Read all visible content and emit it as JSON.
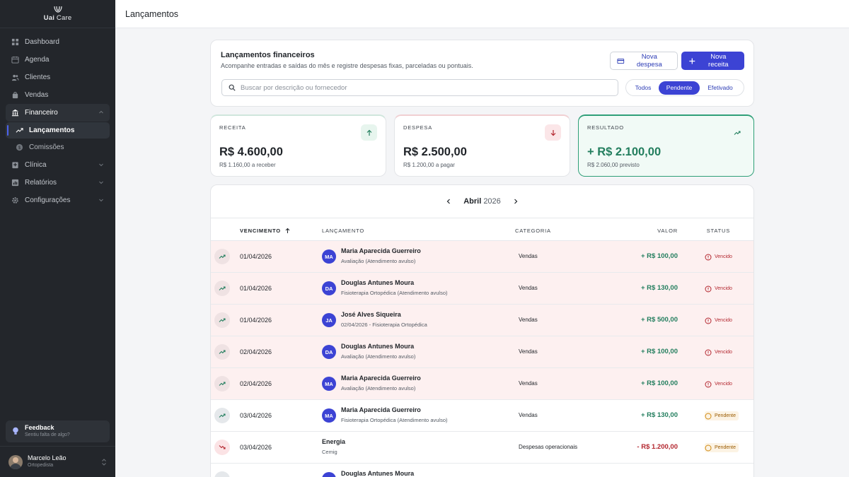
{
  "app": {
    "brand_bold": "Uai",
    "brand_light": "Care",
    "page_title": "Lançamentos"
  },
  "sidebar": {
    "items": [
      {
        "label": "Dashboard",
        "icon": "grid-icon"
      },
      {
        "label": "Agenda",
        "icon": "calendar-icon"
      },
      {
        "label": "Clientes",
        "icon": "users-icon"
      },
      {
        "label": "Vendas",
        "icon": "bag-icon"
      },
      {
        "label": "Financeiro",
        "icon": "bank-icon"
      },
      {
        "label": "Lançamentos",
        "icon": "trend-icon"
      },
      {
        "label": "Comissões",
        "icon": "coin-icon"
      },
      {
        "label": "Clínica",
        "icon": "clinic-icon"
      },
      {
        "label": "Relatórios",
        "icon": "chart-icon"
      },
      {
        "label": "Configurações",
        "icon": "gear-icon"
      }
    ],
    "feedback_title": "Feedback",
    "feedback_sub": "Sentiu falta de algo?",
    "user_name": "Marcelo Leão",
    "user_role": "Ortopedista"
  },
  "header": {
    "title": "Lançamentos financeiros",
    "subtitle": "Acompanhe entradas e saídas do mês e registre despesas fixas, parceladas ou pontuais.",
    "btn_despesa": "Nova despesa",
    "btn_receita": "Nova receita",
    "search_placeholder": "Buscar por descrição ou fornecedor",
    "filters": [
      "Todos",
      "Pendente",
      "Efetivado"
    ]
  },
  "summary": {
    "receita": {
      "label": "RECEITA",
      "value": "R$ 4.600,00",
      "note": "R$ 1.160,00 a receber"
    },
    "despesa": {
      "label": "DESPESA",
      "value": "R$ 2.500,00",
      "note": "R$ 1.200,00 a pagar"
    },
    "resultado": {
      "label": "RESULTADO",
      "value": "+ R$ 2.100,00",
      "note": "R$ 2.060,00 previsto"
    }
  },
  "month": {
    "name": "Abril",
    "year": "2026"
  },
  "table": {
    "headers": {
      "vencimento": "VENCIMENTO",
      "lancamento": "LANÇAMENTO",
      "categoria": "CATEGORIA",
      "valor": "VALOR",
      "status": "STATUS"
    },
    "rows": [
      {
        "date": "01/04/2026",
        "initials": "MA",
        "name": "Maria Aparecida Guerreiro",
        "desc": "Avaliação (Atendimento avulso)",
        "category": "Vendas",
        "value": "+ R$ 100,00",
        "status": "Vencido"
      },
      {
        "date": "01/04/2026",
        "initials": "DA",
        "name": "Douglas Antunes Moura",
        "desc": "Fisioterapia Ortopédica (Atendimento avulso)",
        "category": "Vendas",
        "value": "+ R$ 130,00",
        "status": "Vencido"
      },
      {
        "date": "01/04/2026",
        "initials": "JA",
        "name": "José Alves Siqueira",
        "desc": "02/04/2026 - Fisioterapia Ortopédica",
        "category": "Vendas",
        "value": "+ R$ 500,00",
        "status": "Vencido"
      },
      {
        "date": "02/04/2026",
        "initials": "DA",
        "name": "Douglas Antunes Moura",
        "desc": "Avaliação (Atendimento avulso)",
        "category": "Vendas",
        "value": "+ R$ 100,00",
        "status": "Vencido"
      },
      {
        "date": "02/04/2026",
        "initials": "MA",
        "name": "Maria Aparecida Guerreiro",
        "desc": "Avaliação (Atendimento avulso)",
        "category": "Vendas",
        "value": "+ R$ 100,00",
        "status": "Vencido"
      },
      {
        "date": "03/04/2026",
        "initials": "MA",
        "name": "Maria Aparecida Guerreiro",
        "desc": "Fisioterapia Ortopédica (Atendimento avulso)",
        "category": "Vendas",
        "value": "+ R$ 130,00",
        "status": "Pendente"
      },
      {
        "date": "03/04/2026",
        "initials": "",
        "name": "Energia",
        "desc": "Cemig",
        "category": "Despesas operacionais",
        "value": "- R$ 1.200,00",
        "status": "Pendente"
      },
      {
        "date": "",
        "initials": "DA",
        "name": "Douglas Antunes Moura",
        "desc": "",
        "category": "",
        "value": "",
        "status": ""
      }
    ]
  },
  "colors": {
    "accent": "#3c43d4",
    "income": "#237e5e",
    "expense": "#b3262e",
    "sidebar": "#23262b"
  }
}
